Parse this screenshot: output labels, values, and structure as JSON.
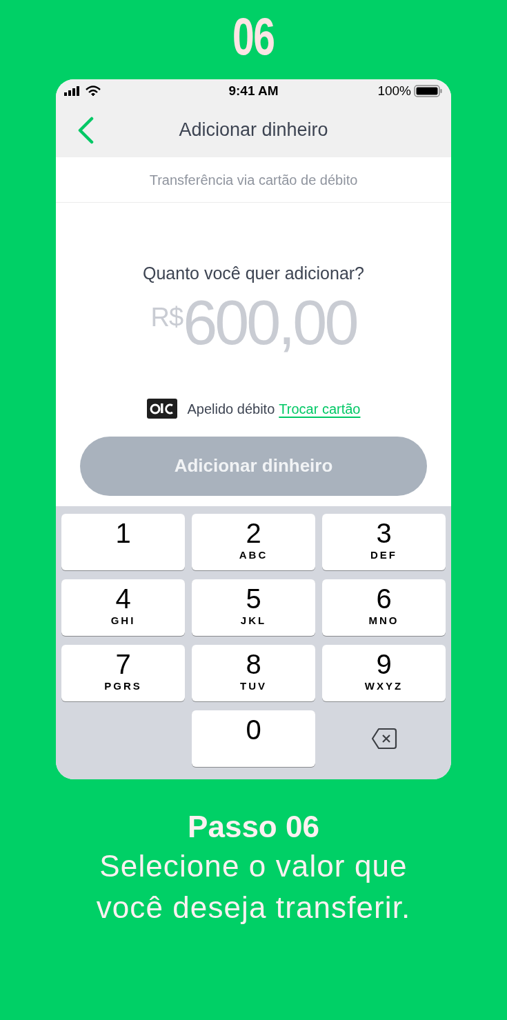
{
  "step_number": "06",
  "phone": {
    "status_bar": {
      "time": "9:41 AM",
      "battery": "100%"
    },
    "nav": {
      "title": "Adicionar dinheiro"
    },
    "subtitle": "Transferência via cartão de débito",
    "question": "Quanto você quer adicionar?",
    "amount": {
      "currency": "R$",
      "value": "600,00"
    },
    "card": {
      "name": "Apelido débito",
      "link": "Trocar cartão"
    },
    "button": {
      "label": "Adicionar dinheiro",
      "disabled": true
    },
    "keypad": [
      {
        "kind": "digit",
        "digit": "1"
      },
      {
        "kind": "digit",
        "digit": "2",
        "letters": "ABC"
      },
      {
        "kind": "digit",
        "digit": "3",
        "letters": "DEF"
      },
      {
        "kind": "digit",
        "digit": "4",
        "letters": "GHI"
      },
      {
        "kind": "digit",
        "digit": "5",
        "letters": "JKL"
      },
      {
        "kind": "digit",
        "digit": "6",
        "letters": "MNO"
      },
      {
        "kind": "digit",
        "digit": "7",
        "letters": "PGRS"
      },
      {
        "kind": "digit",
        "digit": "8",
        "letters": "TUV"
      },
      {
        "kind": "digit",
        "digit": "9",
        "letters": "WXYZ"
      },
      {
        "kind": "digit",
        "digit": "0"
      },
      {
        "kind": "backspace"
      }
    ]
  },
  "caption": {
    "title": "Passo 06",
    "text": "Selecione o valor que você deseja transferir."
  }
}
